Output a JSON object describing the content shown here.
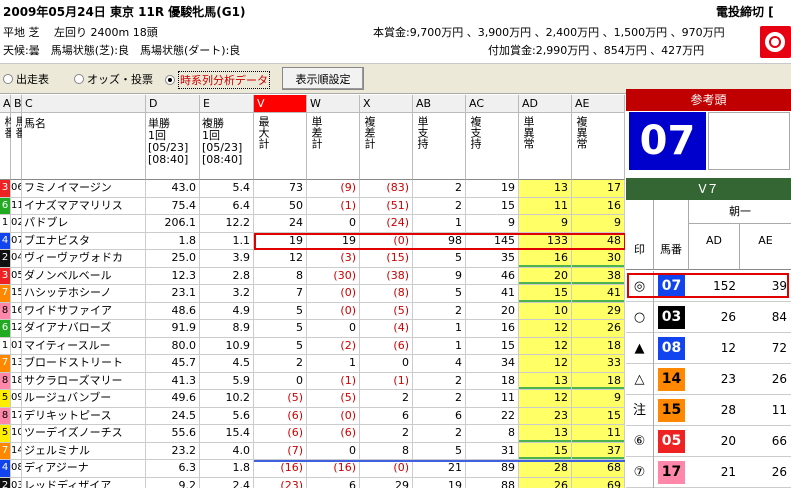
{
  "header": {
    "race_line": "2009年05月24日 東京 11R 優駿牝馬(G1)",
    "course_line": "平地 芝　 左回り 2400m 18頭",
    "cond_line": "天候:曇　馬場状態(芝):良　馬場状態(ダート):良",
    "prize_line": "本賞金:9,700万円 、3,900万円 、2,400万円 、1,500万円 、970万円",
    "addprize_line": "付加賞金:2,990万円 、854万円 、427万円",
    "deadline": "電投締切 [",
    "logo_icon": "target-logo-icon"
  },
  "toolbar": {
    "radio1": "出走表",
    "radio2": "オッズ・投票",
    "radio3": "時系列分析データ",
    "selected": "radio3",
    "order_button": "表示順設定"
  },
  "columns": {
    "letters": [
      "A",
      "B",
      "C",
      "D",
      "E",
      "V",
      "W",
      "X",
      "AB",
      "AC",
      "AD",
      "AE"
    ],
    "titles": [
      "枠番",
      "馬番",
      "馬名",
      "単勝\n1回\n[05/23]\n[08:40]",
      "複勝\n1回\n[05/23]\n[08:40]",
      "最大計",
      "単差計",
      "複差計",
      "単支持",
      "複支持",
      "単異常",
      "複異常"
    ]
  },
  "rows": [
    {
      "waku": "3",
      "uma": "06",
      "name": "フミノイマージン",
      "tan": "43.0",
      "fuku": "5.4",
      "V": "73",
      "W": "(9)",
      "X": "(83)",
      "AB": "2",
      "AC": "19",
      "AD": "13",
      "AE": "17",
      "wc": "#ee2222",
      "wf": "#fff"
    },
    {
      "waku": "6",
      "uma": "11",
      "name": "イナズマアマリリス",
      "tan": "75.4",
      "fuku": "6.4",
      "V": "50",
      "W": "(1)",
      "X": "(51)",
      "AB": "2",
      "AC": "15",
      "AD": "11",
      "AE": "16",
      "wc": "#22aa22",
      "wf": "#fff"
    },
    {
      "waku": "1",
      "uma": "02",
      "name": "パドブレ",
      "tan": "206.1",
      "fuku": "12.2",
      "V": "24",
      "W": "0",
      "X": "(24)",
      "AB": "1",
      "AC": "9",
      "AD": "9",
      "AE": "9",
      "wc": "#ffffff",
      "wf": "#000"
    },
    {
      "waku": "4",
      "uma": "07",
      "name": "ブエナビスタ",
      "tan": "1.8",
      "fuku": "1.1",
      "V": "19",
      "W": "19",
      "X": "(0)",
      "AB": "98",
      "AC": "145",
      "AD": "133",
      "AE": "48",
      "wc": "#1144ee",
      "wf": "#fff"
    },
    {
      "waku": "2",
      "uma": "04",
      "name": "ヴィーヴァヴォドカ",
      "tan": "25.0",
      "fuku": "3.9",
      "V": "12",
      "W": "(3)",
      "X": "(15)",
      "AB": "5",
      "AC": "35",
      "AD": "16",
      "AE": "30",
      "wc": "#111111",
      "wf": "#fff"
    },
    {
      "waku": "3",
      "uma": "05",
      "name": "ダノンベルベール",
      "tan": "12.3",
      "fuku": "2.8",
      "V": "8",
      "W": "(30)",
      "X": "(38)",
      "AB": "9",
      "AC": "46",
      "AD": "20",
      "AE": "38",
      "wc": "#ee2222",
      "wf": "#fff"
    },
    {
      "waku": "7",
      "uma": "15",
      "name": "ハシッテホシーノ",
      "tan": "23.1",
      "fuku": "3.2",
      "V": "7",
      "W": "(0)",
      "X": "(8)",
      "AB": "5",
      "AC": "41",
      "AD": "15",
      "AE": "41",
      "wc": "#ff8800",
      "wf": "#fff"
    },
    {
      "waku": "8",
      "uma": "16",
      "name": "ワイドサファイア",
      "tan": "48.6",
      "fuku": "4.9",
      "V": "5",
      "W": "(0)",
      "X": "(5)",
      "AB": "2",
      "AC": "20",
      "AD": "10",
      "AE": "29",
      "wc": "#ff88aa",
      "wf": "#000"
    },
    {
      "waku": "6",
      "uma": "12",
      "name": "ダイアナバローズ",
      "tan": "91.9",
      "fuku": "8.9",
      "V": "5",
      "W": "0",
      "X": "(4)",
      "AB": "1",
      "AC": "16",
      "AD": "12",
      "AE": "26",
      "wc": "#22aa22",
      "wf": "#fff"
    },
    {
      "waku": "1",
      "uma": "01",
      "name": "マイティースルー",
      "tan": "80.0",
      "fuku": "10.9",
      "V": "5",
      "W": "(2)",
      "X": "(6)",
      "AB": "1",
      "AC": "15",
      "AD": "12",
      "AE": "18",
      "wc": "#ffffff",
      "wf": "#000"
    },
    {
      "waku": "7",
      "uma": "13",
      "name": "ブロードストリート",
      "tan": "45.7",
      "fuku": "4.5",
      "V": "2",
      "W": "1",
      "X": "0",
      "AB": "4",
      "AC": "34",
      "AD": "12",
      "AE": "33",
      "wc": "#ff8800",
      "wf": "#fff"
    },
    {
      "waku": "8",
      "uma": "18",
      "name": "サクラローズマリー",
      "tan": "41.3",
      "fuku": "5.9",
      "V": "0",
      "W": "(1)",
      "X": "(1)",
      "AB": "2",
      "AC": "18",
      "AD": "13",
      "AE": "18",
      "wc": "#ff88aa",
      "wf": "#000"
    },
    {
      "waku": "5",
      "uma": "09",
      "name": "ルージュバンブー",
      "tan": "49.6",
      "fuku": "10.2",
      "V": "(5)",
      "W": "(5)",
      "X": "2",
      "AB": "2",
      "AC": "11",
      "AD": "12",
      "AE": "9",
      "wc": "#ffee00",
      "wf": "#000"
    },
    {
      "waku": "8",
      "uma": "17",
      "name": "デリキットピース",
      "tan": "24.5",
      "fuku": "5.6",
      "V": "(6)",
      "W": "(0)",
      "X": "6",
      "AB": "6",
      "AC": "22",
      "AD": "23",
      "AE": "15",
      "wc": "#ff88aa",
      "wf": "#000"
    },
    {
      "waku": "5",
      "uma": "10",
      "name": "ツーデイズノーチス",
      "tan": "55.6",
      "fuku": "15.4",
      "V": "(6)",
      "W": "(6)",
      "X": "2",
      "AB": "2",
      "AC": "8",
      "AD": "13",
      "AE": "11",
      "wc": "#ffee00",
      "wf": "#000"
    },
    {
      "waku": "7",
      "uma": "14",
      "name": "ジェルミナル",
      "tan": "23.2",
      "fuku": "4.0",
      "V": "(7)",
      "W": "0",
      "X": "8",
      "AB": "5",
      "AC": "31",
      "AD": "15",
      "AE": "37",
      "wc": "#ff8800",
      "wf": "#fff"
    },
    {
      "waku": "4",
      "uma": "08",
      "name": "ディアジーナ",
      "tan": "6.3",
      "fuku": "1.8",
      "V": "(16)",
      "W": "(16)",
      "X": "(0)",
      "AB": "21",
      "AC": "89",
      "AD": "28",
      "AE": "68",
      "wc": "#1144ee",
      "wf": "#fff"
    },
    {
      "waku": "2",
      "uma": "03",
      "name": "レッドディザイア",
      "tan": "9.2",
      "fuku": "2.4",
      "V": "(23)",
      "W": "6",
      "X": "29",
      "AB": "19",
      "AC": "88",
      "AD": "26",
      "AE": "69",
      "wc": "#111111",
      "wf": "#fff"
    }
  ],
  "panel": {
    "ref_title": "参考頭",
    "ref_number": "07",
    "v7_title": "V７",
    "mark_header": "印",
    "umaban_header": "馬番",
    "morning_header": "朝一",
    "ad_header": "AD",
    "ae_header": "AE",
    "rows": [
      {
        "mark": "◎",
        "uma": "07",
        "ad": "152",
        "ae": "39",
        "bg": "#1144ee",
        "fg": "#fff"
      },
      {
        "mark": "○",
        "uma": "03",
        "ad": "26",
        "ae": "84",
        "bg": "#000000",
        "fg": "#fff"
      },
      {
        "mark": "▲",
        "uma": "08",
        "ad": "12",
        "ae": "72",
        "bg": "#1144ee",
        "fg": "#fff"
      },
      {
        "mark": "△",
        "uma": "14",
        "ad": "23",
        "ae": "26",
        "bg": "#ff8800",
        "fg": "#000"
      },
      {
        "mark": "注",
        "uma": "15",
        "ad": "28",
        "ae": "11",
        "bg": "#ff8800",
        "fg": "#000"
      },
      {
        "mark": "⑥",
        "uma": "05",
        "ad": "20",
        "ae": "66",
        "bg": "#ee2222",
        "fg": "#fff"
      },
      {
        "mark": "⑦",
        "uma": "17",
        "ad": "21",
        "ae": "26",
        "bg": "#ff88aa",
        "fg": "#000"
      }
    ]
  }
}
